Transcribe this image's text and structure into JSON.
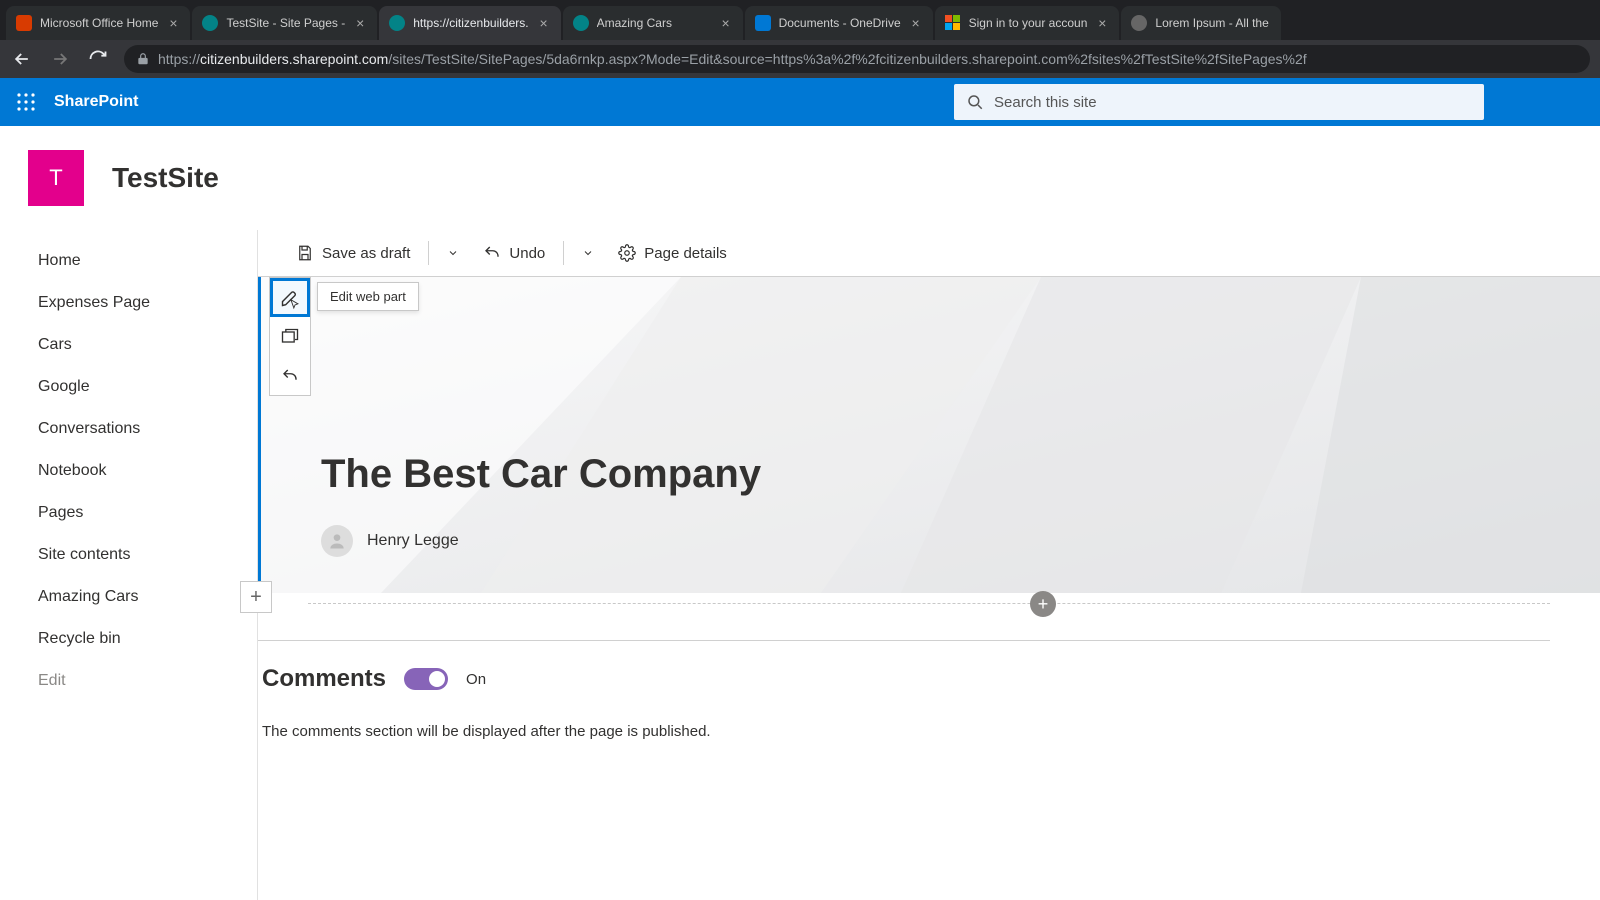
{
  "browser": {
    "tabs": [
      {
        "title": "Microsoft Office Home"
      },
      {
        "title": "TestSite - Site Pages - "
      },
      {
        "title": "https://citizenbuilders."
      },
      {
        "title": "Amazing Cars"
      },
      {
        "title": "Documents - OneDrive"
      },
      {
        "title": "Sign in to your accoun"
      },
      {
        "title": "Lorem Ipsum - All the"
      }
    ],
    "url_domain": "citizenbuilders.sharepoint.com",
    "url_path": "/sites/TestSite/SitePages/5da6rnkp.aspx?Mode=Edit&source=https%3a%2f%2fcitizenbuilders.sharepoint.com%2fsites%2fTestSite%2fSitePages%2f",
    "url_prefix": "https://"
  },
  "suite": {
    "brand": "SharePoint",
    "search_placeholder": "Search this site"
  },
  "site": {
    "logo_letter": "T",
    "title": "TestSite"
  },
  "nav": {
    "items": [
      "Home",
      "Expenses Page",
      "Cars",
      "Google",
      "Conversations",
      "Notebook",
      "Pages",
      "Site contents",
      "Amazing Cars",
      "Recycle bin"
    ],
    "edit": "Edit"
  },
  "commands": {
    "save": "Save as draft",
    "undo": "Undo",
    "details": "Page details"
  },
  "banner": {
    "title": "The Best Car Company",
    "author": "Henry Legge",
    "tooltip": "Edit web part"
  },
  "comments": {
    "title": "Comments",
    "state": "On",
    "message": "The comments section will be displayed after the page is published."
  }
}
